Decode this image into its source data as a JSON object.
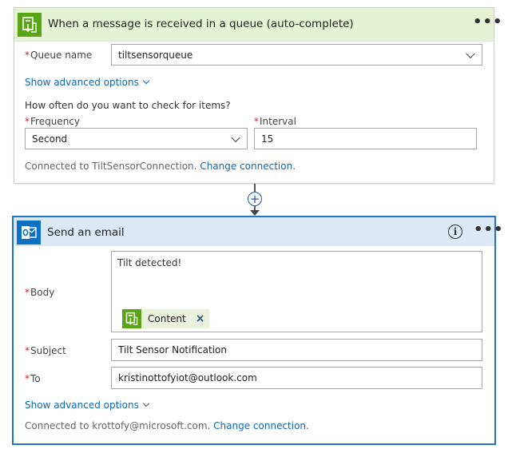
{
  "trigger": {
    "title": "When a message is received in a queue (auto-complete)",
    "menu_label": "•••",
    "queue_name_label": "Queue name",
    "queue_name_value": "tiltsensorqueue",
    "advanced_options_label": "Show advanced options",
    "check_question": "How often do you want to check for items?",
    "frequency_label": "Frequency",
    "frequency_value": "Second",
    "interval_label": "Interval",
    "interval_value": "15",
    "connected_text": "Connected to TiltSensorConnection.",
    "change_connection_label": "Change connection.",
    "icon": "service-bus-icon"
  },
  "connector": {
    "add_label": "+"
  },
  "action": {
    "title": "Send an email",
    "menu_label": "•••",
    "body_label": "Body",
    "body_text": "Tilt detected!",
    "token_label": "Content",
    "token_remove": "×",
    "subject_label": "Subject",
    "subject_value": "Tilt Sensor Notification",
    "to_label": "To",
    "to_value": "kristinottofyiot@outlook.com",
    "advanced_options_label": "Show advanced options",
    "connected_text": "Connected to krottofy@microsoft.com.",
    "change_connection_label": "Change connection.",
    "icon": "outlook-icon"
  },
  "required_marker": "*",
  "colors": {
    "trigger_header": "#e6f2d4",
    "trigger_icon": "#5aa516",
    "action_header": "#dbe8f5",
    "action_border": "#1f74c3",
    "outlook_icon": "#0c71c6",
    "link": "#0f66b3",
    "required": "#c4262e"
  }
}
